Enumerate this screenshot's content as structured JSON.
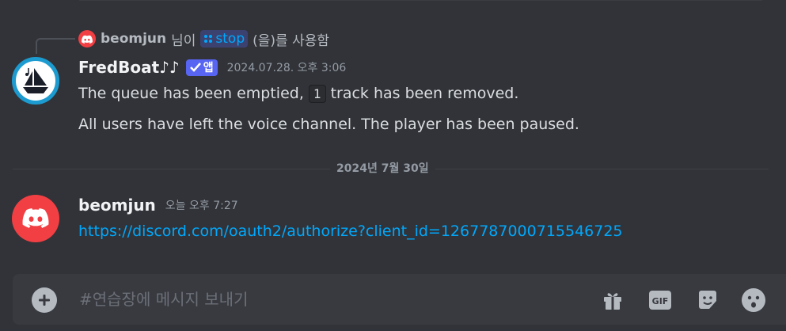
{
  "reply": {
    "username": "beomjun",
    "text_prefix": "님이",
    "command": "stop",
    "text_suffix": "(을)를 사용함"
  },
  "bot_message": {
    "username": "FredBoat♪♪",
    "badge": "앱",
    "timestamp": "2024.07.28. 오후 3:06",
    "line1_before": "The queue has been emptied, ",
    "line1_code": "1",
    "line1_after": " track has been removed.",
    "line2": "All users have left the voice channel. The player has been paused."
  },
  "date_divider": "2024년 7월 30일",
  "user_message": {
    "username": "beomjun",
    "timestamp": "오늘 오후 7:27",
    "link": "https://discord.com/oauth2/authorize?client_id=1267787000715546725"
  },
  "composer": {
    "placeholder": "#연습장에 메시지 보내기"
  },
  "colors": {
    "background": "#313338",
    "link": "#00a8fc",
    "app_badge": "#5865f2",
    "user_avatar": "#f23f43"
  }
}
